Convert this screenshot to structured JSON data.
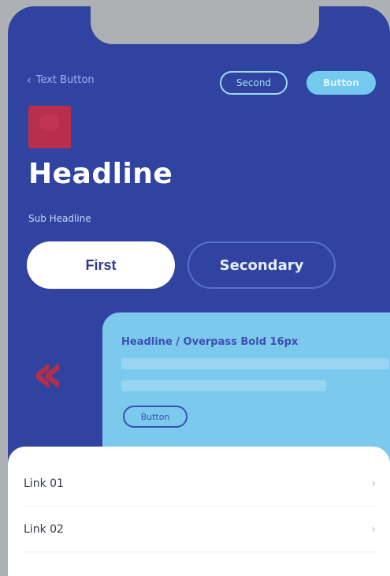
{
  "topbar": {
    "back_label": "Text Button",
    "second_label": "Second",
    "button_label": "Button"
  },
  "hero": {
    "headline": "Headline",
    "subheadline": "Sub Headline"
  },
  "actions": {
    "first_label": "First",
    "secondary_label": "Secondary"
  },
  "card": {
    "title": "Headline / Overpass Bold 16px",
    "button_label": "Button"
  },
  "links": [
    {
      "label": "Link 01"
    },
    {
      "label": "Link 02"
    }
  ],
  "colors": {
    "background": "#3143a0",
    "accent_red": "#b72f4d",
    "accent_cyan": "#73c9ee",
    "card": "#7cc9ee"
  }
}
